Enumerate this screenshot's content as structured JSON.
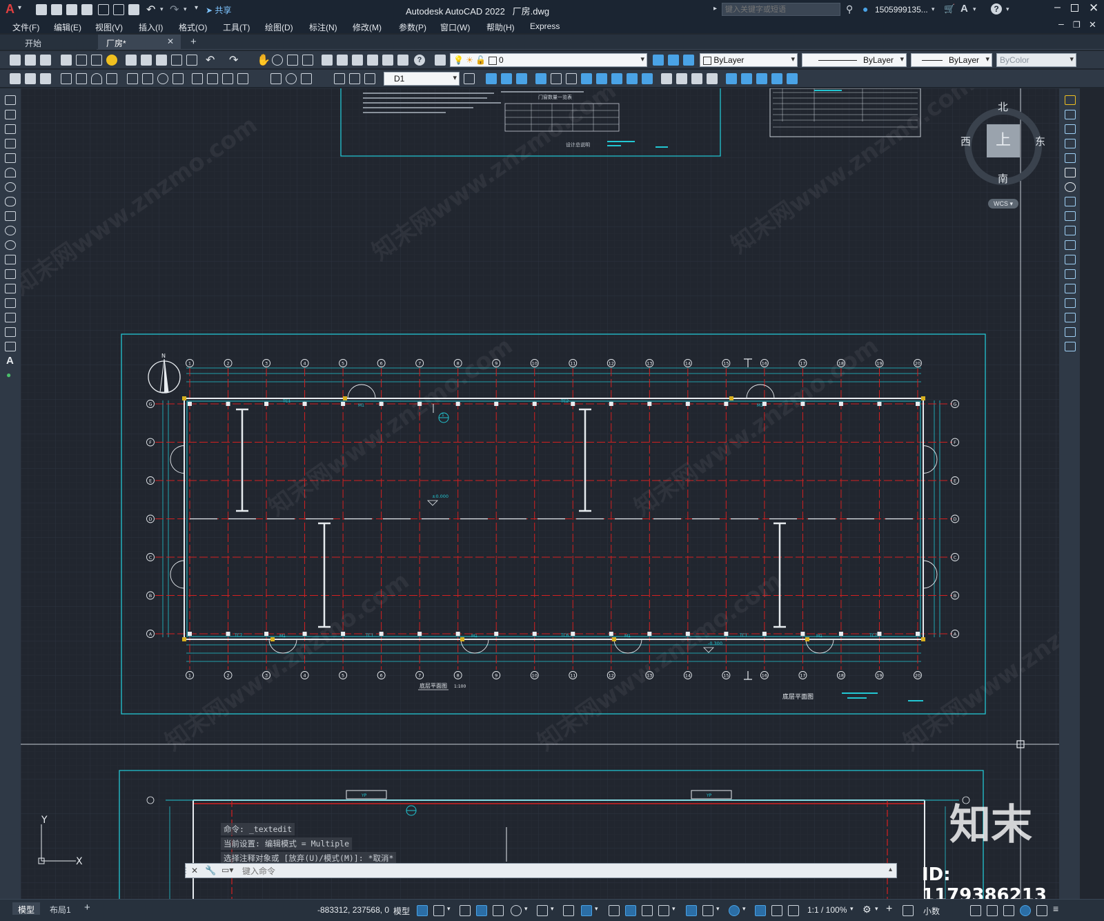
{
  "app": {
    "title": "Autodesk AutoCAD 2022",
    "file": "厂房.dwg",
    "search_placeholder": "键入关键字或短语",
    "user": "1505999135...",
    "share": "共享"
  },
  "menu": [
    "文件(F)",
    "编辑(E)",
    "视图(V)",
    "插入(I)",
    "格式(O)",
    "工具(T)",
    "绘图(D)",
    "标注(N)",
    "修改(M)",
    "参数(P)",
    "窗口(W)",
    "帮助(H)",
    "Express"
  ],
  "tabs": [
    {
      "label": "开始"
    },
    {
      "label": "厂房*"
    }
  ],
  "toolbar": {
    "layer": "0",
    "color": "ByLayer",
    "linetype": "ByLayer",
    "lineweight": "ByLayer",
    "plotstyle": "ByColor",
    "dimstyle": "D1"
  },
  "viewcube": {
    "north": "北",
    "south": "南",
    "east": "东",
    "west": "西",
    "top": "上",
    "wcs": "WCS"
  },
  "drawing": {
    "plan_title": "底层平面图",
    "plan_title_small": "底层平面图",
    "plan_scale": "1:100",
    "elevation_label": "±0.000",
    "elevation_label2": "-0.300",
    "north_label": "N",
    "top_sheet_title": "设计总说明",
    "top_table_title": "门窗数量一览表",
    "axis_numbers": [
      "1",
      "2",
      "3",
      "4",
      "5",
      "6",
      "7",
      "8",
      "9",
      "10",
      "11",
      "12",
      "13",
      "14",
      "15",
      "16",
      "17",
      "18",
      "19",
      "20"
    ],
    "axis_letters": [
      "G",
      "F",
      "E",
      "D",
      "C",
      "B",
      "A"
    ],
    "door_tags": [
      "M1",
      "M1",
      "M1",
      "M1",
      "M1",
      "M1"
    ],
    "window_tags": [
      "TC1",
      "TC2",
      "TC3",
      "TC4",
      "TC5",
      "TC6",
      "TC7"
    ],
    "yp_label": "YP",
    "section_label": "1"
  },
  "command": {
    "history": [
      "命令: _textedit",
      "当前设置: 编辑模式 = Multiple",
      "选择注释对象或 [放弃(U)/模式(M)]: *取消*"
    ],
    "placeholder": "键入命令"
  },
  "layout_tabs": [
    "模型",
    "布局1"
  ],
  "status": {
    "coords": "-883312, 237568, 0",
    "mode": "模型",
    "scale": "1:1 / 100%",
    "units": "小数"
  },
  "watermark": {
    "brand": "知末",
    "id": "ID: 1179386213",
    "site": "知末网www.znzmo.com"
  }
}
